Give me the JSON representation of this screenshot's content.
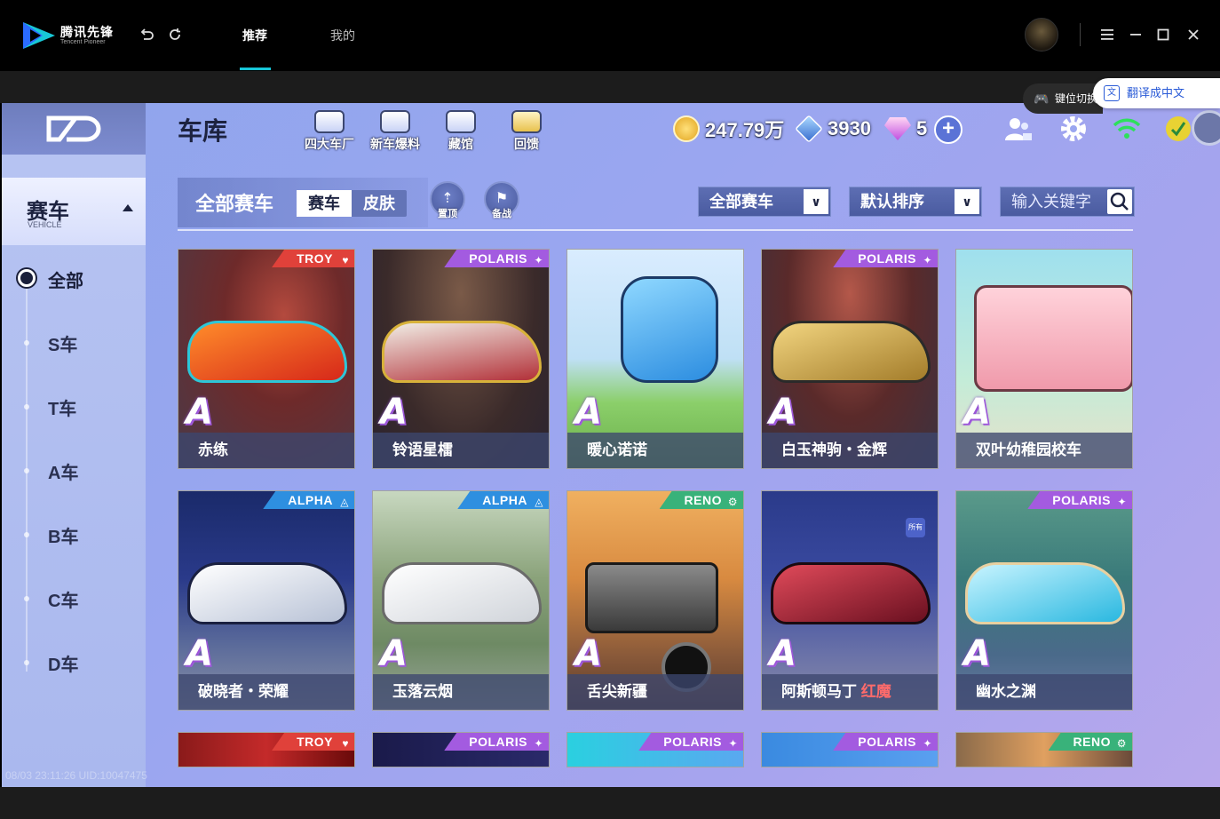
{
  "titlebar": {
    "brand_cn": "腾讯先锋",
    "brand_en": "Tencent Pioneer",
    "tabs": [
      {
        "label": "推荐",
        "active": true
      },
      {
        "label": "我的",
        "active": false
      }
    ],
    "icons": [
      "undo-icon",
      "refresh-icon",
      "menu-icon",
      "minimize-icon",
      "maximize-icon",
      "close-icon"
    ]
  },
  "overlay": {
    "keypos_label": "键位切换",
    "translate_label": "翻译成中文"
  },
  "game": {
    "page_title": "车库",
    "header_buttons": [
      {
        "label": "四大车厂"
      },
      {
        "label": "新车爆料"
      },
      {
        "label": "藏馆"
      },
      {
        "label": "回馈"
      }
    ],
    "currencies": {
      "coins": "247.79万",
      "points": "3930",
      "diamonds": "5"
    },
    "sidebar": {
      "category": "赛车",
      "category_en": "VEHICLE",
      "items": [
        {
          "label": "全部",
          "active": true
        },
        {
          "label": "S车"
        },
        {
          "label": "T车"
        },
        {
          "label": "A车"
        },
        {
          "label": "B车"
        },
        {
          "label": "C车"
        },
        {
          "label": "D车"
        }
      ]
    },
    "filter": {
      "title": "全部赛车",
      "segments": [
        {
          "label": "赛车",
          "active": true
        },
        {
          "label": "皮肤",
          "active": false
        }
      ],
      "pin_label": "置顶",
      "prepare_label": "备战",
      "type_dropdown": "全部赛车",
      "sort_dropdown": "默认排序",
      "search_placeholder": "输入关键字"
    },
    "cars": [
      {
        "name": "赤练",
        "brand": "TROY",
        "grade": "A",
        "brand_color": "#e0413a"
      },
      {
        "name": "铃语星檑",
        "brand": "POLARIS",
        "grade": "A",
        "brand_color": "#a35be0"
      },
      {
        "name": "暖心诺诺",
        "brand": "",
        "grade": "A",
        "brand_color": ""
      },
      {
        "name": "白玉神驹・金辉",
        "brand": "POLARIS",
        "grade": "A",
        "brand_color": "#a35be0"
      },
      {
        "name": "双叶幼稚园校车",
        "brand": "",
        "grade": "A",
        "brand_color": ""
      },
      {
        "name": "破晓者・荣耀",
        "brand": "ALPHA",
        "grade": "A",
        "brand_color": "#2e8fe0"
      },
      {
        "name": "玉落云烟",
        "brand": "ALPHA",
        "grade": "A",
        "brand_color": "#2e8fe0"
      },
      {
        "name": "舌尖新疆",
        "brand": "RENO",
        "grade": "A",
        "brand_color": "#39b27a"
      },
      {
        "name": "阿斯顿马丁",
        "name_extra": "红魔",
        "brand": "",
        "grade": "A",
        "brand_color": "",
        "owned_badge": "所有"
      },
      {
        "name": "幽水之渊",
        "brand": "POLARIS",
        "grade": "A",
        "brand_color": "#a35be0"
      },
      {
        "name": "",
        "brand": "TROY",
        "grade": "",
        "brand_color": "#e0413a"
      },
      {
        "name": "",
        "brand": "POLARIS",
        "grade": "",
        "brand_color": "#a35be0"
      },
      {
        "name": "",
        "brand": "POLARIS",
        "grade": "",
        "brand_color": "#a35be0"
      },
      {
        "name": "",
        "brand": "POLARIS",
        "grade": "",
        "brand_color": "#a35be0"
      },
      {
        "name": "",
        "brand": "RENO",
        "grade": "",
        "brand_color": "#39b27a"
      }
    ],
    "footer_uid": "08/03 23:11:26 UID:10047475"
  },
  "colors": {
    "accent": "#17c6d8",
    "game_bg": "#9aa6f0",
    "troy": "#e0413a",
    "polaris": "#a35be0",
    "alpha": "#2e8fe0",
    "reno": "#39b27a"
  }
}
